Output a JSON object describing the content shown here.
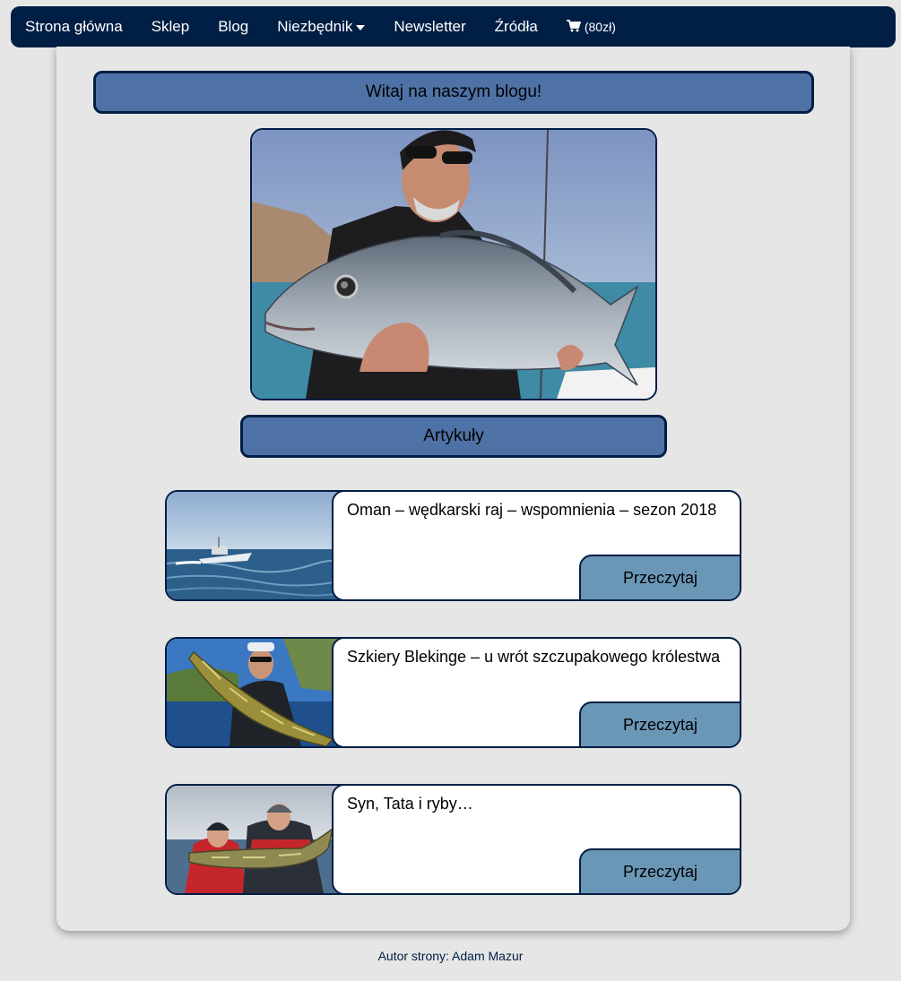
{
  "nav": {
    "items": [
      "Strona główna",
      "Sklep",
      "Blog",
      "Niezbędnik",
      "Newsletter",
      "Źródła"
    ],
    "cart_label": "(80zł)"
  },
  "main": {
    "welcome": "Witaj na naszym blogu!",
    "articles_heading": "Artykuły",
    "articles": [
      {
        "title": "Oman – wędkarski raj – wspomnienia – sezon 2018",
        "button": "Przeczytaj"
      },
      {
        "title": "Szkiery Blekinge – u wrót szczupakowego królestwa",
        "button": "Przeczytaj"
      },
      {
        "title": "Syn, Tata i ryby…",
        "button": "Przeczytaj"
      }
    ]
  },
  "footer": {
    "text": "Autor strony: Adam Mazur"
  },
  "colors": {
    "navbar": "#011e45",
    "heading_bg": "#4f72a6",
    "button_bg": "#6a97b6",
    "page_bg": "#e6e6e6"
  },
  "icons": {
    "cart": "shopping-cart-icon",
    "dropdown": "caret-down-icon"
  }
}
